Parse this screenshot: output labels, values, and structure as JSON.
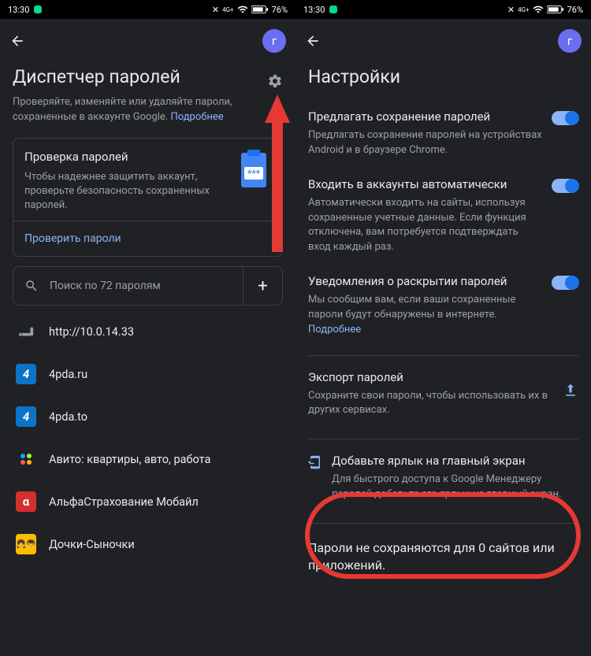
{
  "status": {
    "time": "13:30",
    "battery": "76%"
  },
  "left": {
    "avatar_letter": "г",
    "title": "Диспетчер паролей",
    "subtitle_pre": "Проверяйте, изменяйте или удаляйте пароли, сохраненные в аккаунте Google. ",
    "subtitle_link": "Подробнее",
    "check": {
      "title": "Проверка паролей",
      "body": "Чтобы надежнее защитить аккаунт, проверьте безопасность сохраненных паролей.",
      "action": "Проверить пароли"
    },
    "search_placeholder": "Поиск по 72 паролям",
    "items": [
      {
        "label": "http://10.0.14.33",
        "icon_type": "router"
      },
      {
        "label": "4pda.ru",
        "icon_type": "4pda"
      },
      {
        "label": "4pda.to",
        "icon_type": "4pda"
      },
      {
        "label": "Авито: квартиры, авто, работа",
        "icon_type": "avito"
      },
      {
        "label": "АльфаСтрахование Мобайл",
        "icon_type": "alpha"
      },
      {
        "label": "Дочки-Сыночки",
        "icon_type": "dochki"
      }
    ]
  },
  "right": {
    "avatar_letter": "г",
    "title": "Настройки",
    "settings": [
      {
        "title": "Предлагать сохранение паролей",
        "desc": "Предлагать сохранение паролей на устройствах Android и в браузере Chrome.",
        "toggle": true
      },
      {
        "title": "Входить в аккаунты автоматически",
        "desc": "Автоматически входить на сайты, используя сохраненные учетные данные. Если функция отключена, вам потребуется подтверждать вход каждый раз.",
        "toggle": true
      },
      {
        "title": "Уведомления о раскрытии паролей",
        "desc": "Мы сообщим вам, если ваши сохраненные пароли будут обнаружены в интернете. ",
        "desc_link": "Подробнее",
        "toggle": true
      }
    ],
    "export": {
      "title": "Экспорт паролей",
      "desc": "Сохраните свои пароли, чтобы использовать их в других сервисах."
    },
    "shortcut": {
      "title": "Добавьте ярлык на главный экран",
      "desc": "Для быстрого доступа к Google Менеджеру паролей добавьте его ярлык на главный экран."
    },
    "nosave_title": "Пароли не сохраняются для 0 сайтов или приложений."
  }
}
